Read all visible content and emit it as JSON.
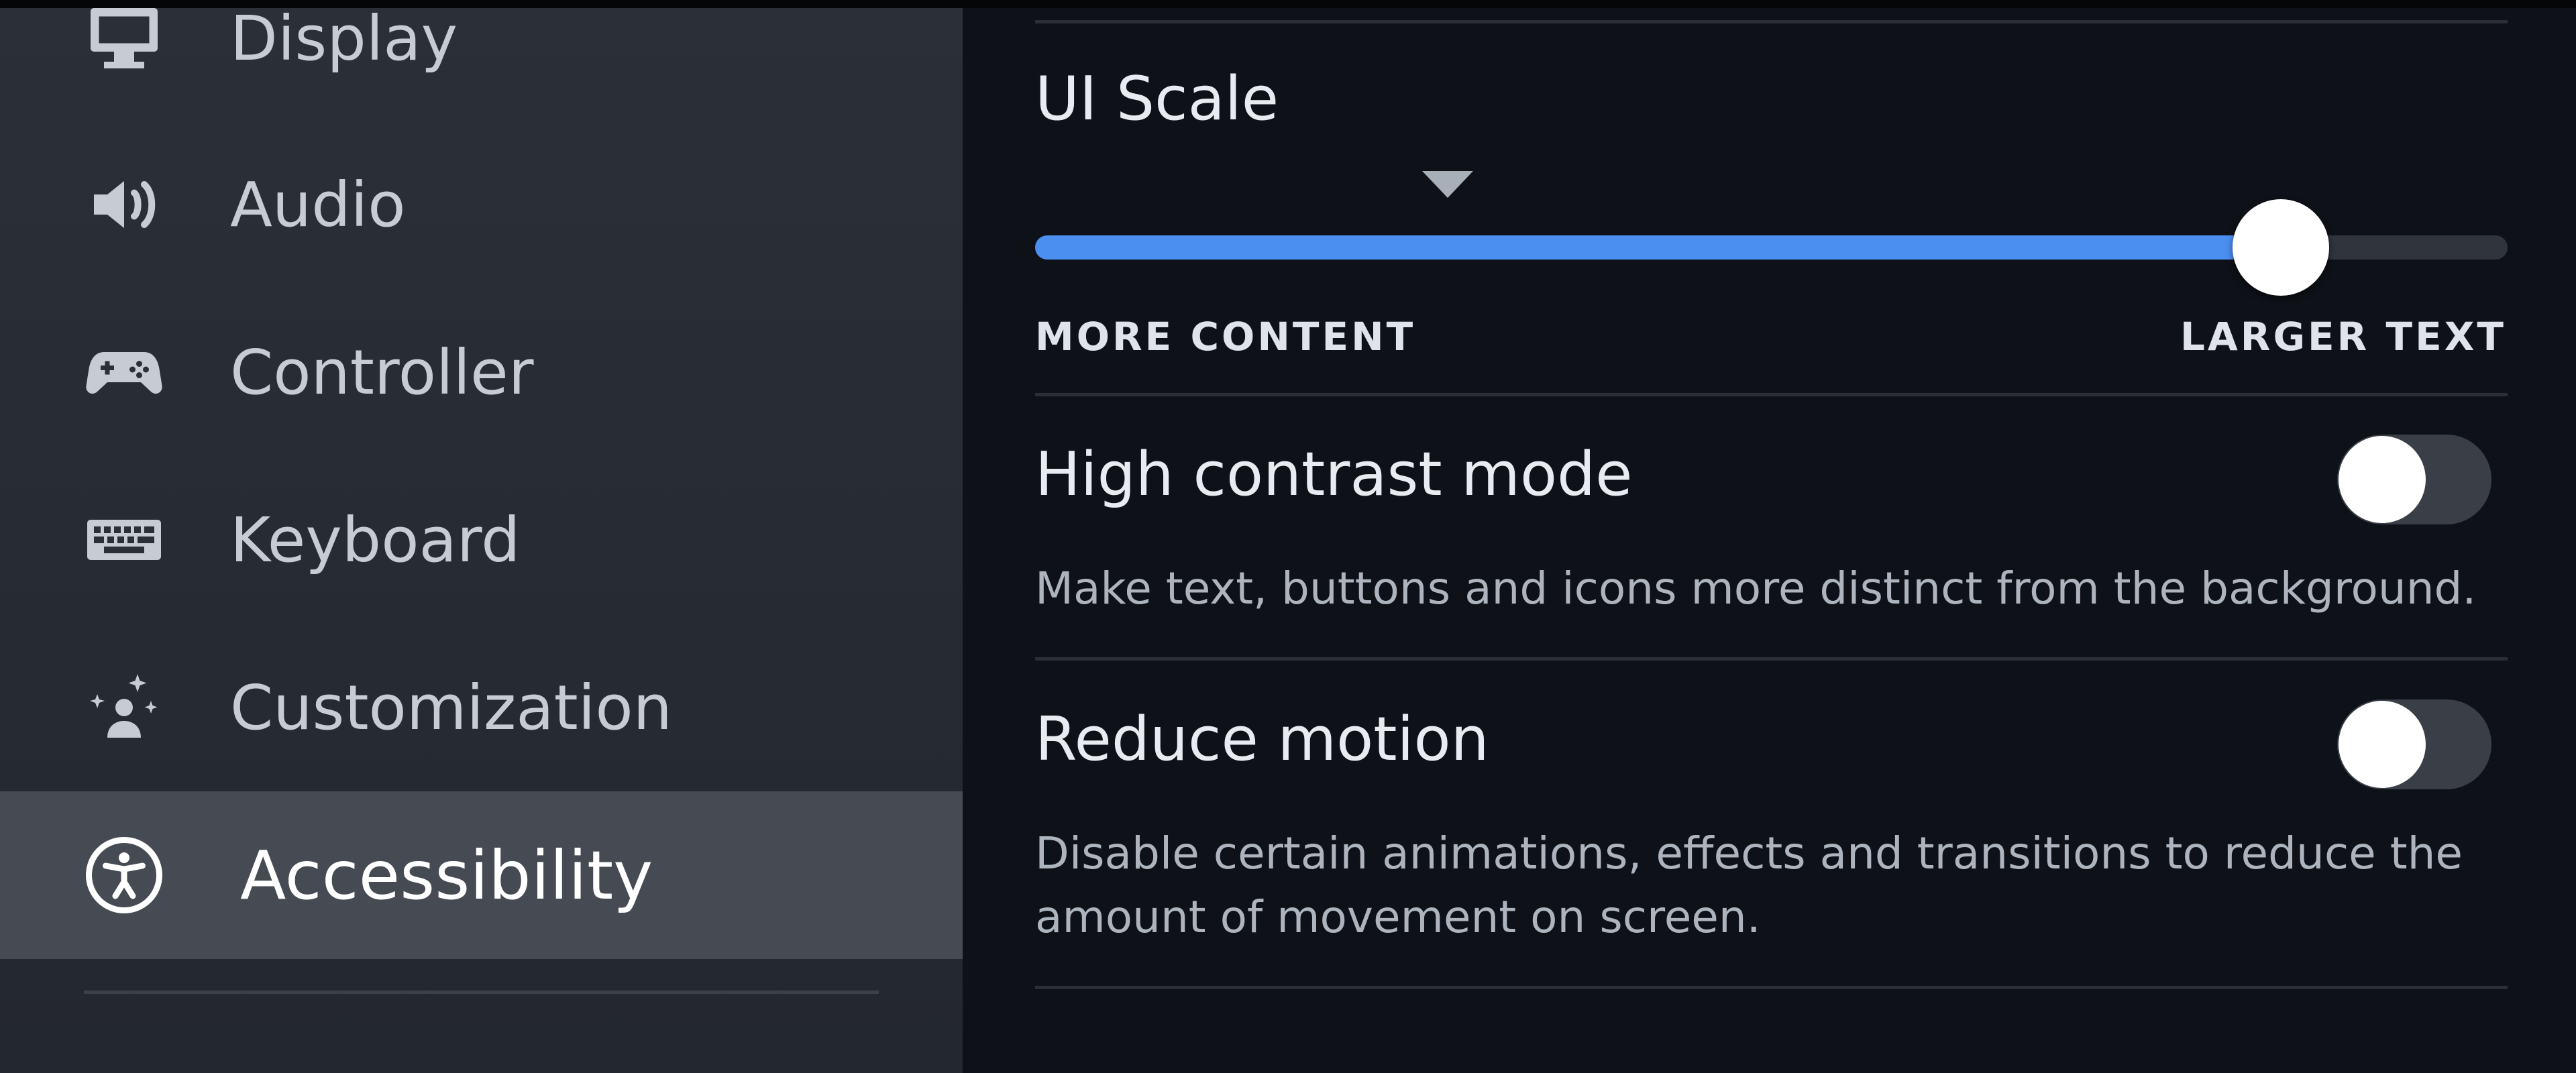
{
  "sidebar": {
    "items": [
      {
        "label": "Display",
        "icon": "monitor-icon",
        "active": false
      },
      {
        "label": "Audio",
        "icon": "speaker-icon",
        "active": false
      },
      {
        "label": "Controller",
        "icon": "gamepad-icon",
        "active": false
      },
      {
        "label": "Keyboard",
        "icon": "keyboard-icon",
        "active": false
      },
      {
        "label": "Customization",
        "icon": "sparkle-person-icon",
        "active": false
      },
      {
        "label": "Accessibility",
        "icon": "accessibility-icon",
        "active": true
      }
    ]
  },
  "ui_scale": {
    "title": "UI Scale",
    "min_label": "MORE CONTENT",
    "max_label": "LARGER TEXT",
    "value_fraction": 0.846,
    "default_fraction": 0.28
  },
  "high_contrast": {
    "title": "High contrast mode",
    "description": "Make text, buttons and icons more distinct from the background.",
    "enabled": false
  },
  "reduce_motion": {
    "title": "Reduce motion",
    "description": "Disable certain animations, effects and transitions to reduce the amount of movement on screen.",
    "enabled": false
  },
  "colors": {
    "accent": "#4b8ff0",
    "sidebar_active": "#464a52",
    "background": "#0e1117"
  }
}
